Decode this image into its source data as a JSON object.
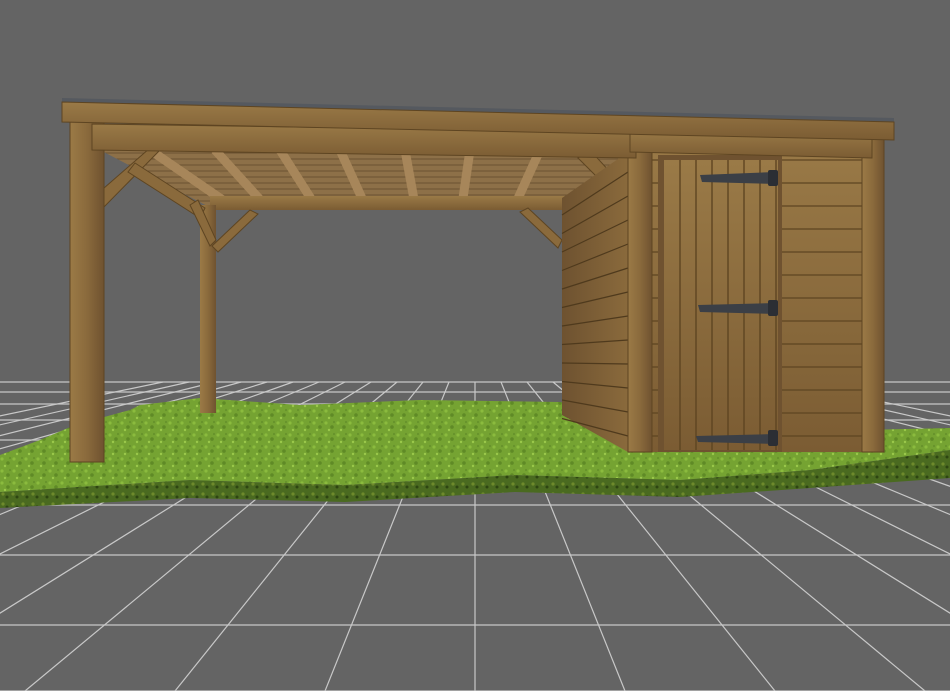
{
  "viewport": {
    "background": "#646464",
    "grid_color": "#c8c8c8",
    "grid_visible": true
  },
  "scene": {
    "ground_color": "#6f9a2e",
    "ground_edge_color": "#3e5a1a",
    "wood_color": "#8a6a3c",
    "wood_dark_color": "#5e4522",
    "hinge_color": "#3b3f46"
  }
}
